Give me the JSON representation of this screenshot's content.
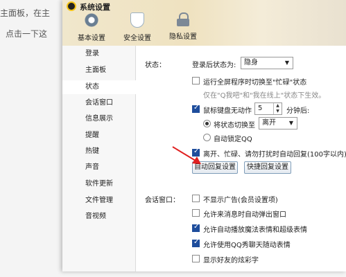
{
  "background": {
    "line1": "主面板，在主",
    "line2": "点击一下这"
  },
  "window": {
    "title": "系统设置"
  },
  "top_tabs": [
    {
      "label": "基本设置",
      "icon": "gear-icon"
    },
    {
      "label": "安全设置",
      "icon": "shield-icon"
    },
    {
      "label": "隐私设置",
      "icon": "lock-icon"
    }
  ],
  "sidebar": {
    "items": [
      {
        "label": "登录"
      },
      {
        "label": "主面板"
      },
      {
        "label": "状态",
        "active": true
      },
      {
        "label": "会话窗口"
      },
      {
        "label": "信息展示"
      },
      {
        "label": "提醒"
      },
      {
        "label": "热键"
      },
      {
        "label": "声音"
      },
      {
        "label": "软件更新"
      },
      {
        "label": "文件管理"
      },
      {
        "label": "音视频"
      }
    ]
  },
  "status_section": {
    "section_label": "状态：",
    "login_status_label": "登录后状态为:",
    "login_status_value": "隐身",
    "fullscreen_busy": {
      "label": "运行全屏程序时切换至\"忙碌\"状态",
      "checked": false
    },
    "fullscreen_hint": "仅在\"Q我吧\"和\"我在线上\"状态下生效。",
    "idle": {
      "label": "鼠标键盘无动作",
      "checked": true,
      "minutes": "5",
      "suffix": "分钟后:"
    },
    "switch_status": {
      "label": "将状态切换至",
      "selected": true,
      "value": "离开"
    },
    "auto_lock": {
      "label": "自动锁定QQ",
      "selected": false
    },
    "auto_reply": {
      "label": "离开、忙碌、请勿打扰时自动回复(100字以内)",
      "checked": true
    },
    "auto_reply_button": "自动回复设置",
    "quick_reply_button": "快捷回复设置"
  },
  "chat_section": {
    "section_label": "会话窗口：",
    "options": [
      {
        "label": "不显示广告(会员设置项)",
        "checked": false
      },
      {
        "label": "允许来消息时自动弹出窗口",
        "checked": false
      },
      {
        "label": "允许自动播放魔法表情和超级表情",
        "checked": true
      },
      {
        "label": "允许使用QQ秀聊天随动表情",
        "checked": true
      },
      {
        "label": "显示好友的炫彩字",
        "checked": false
      }
    ]
  },
  "annotation": {
    "arrow_color": "#e02020"
  }
}
